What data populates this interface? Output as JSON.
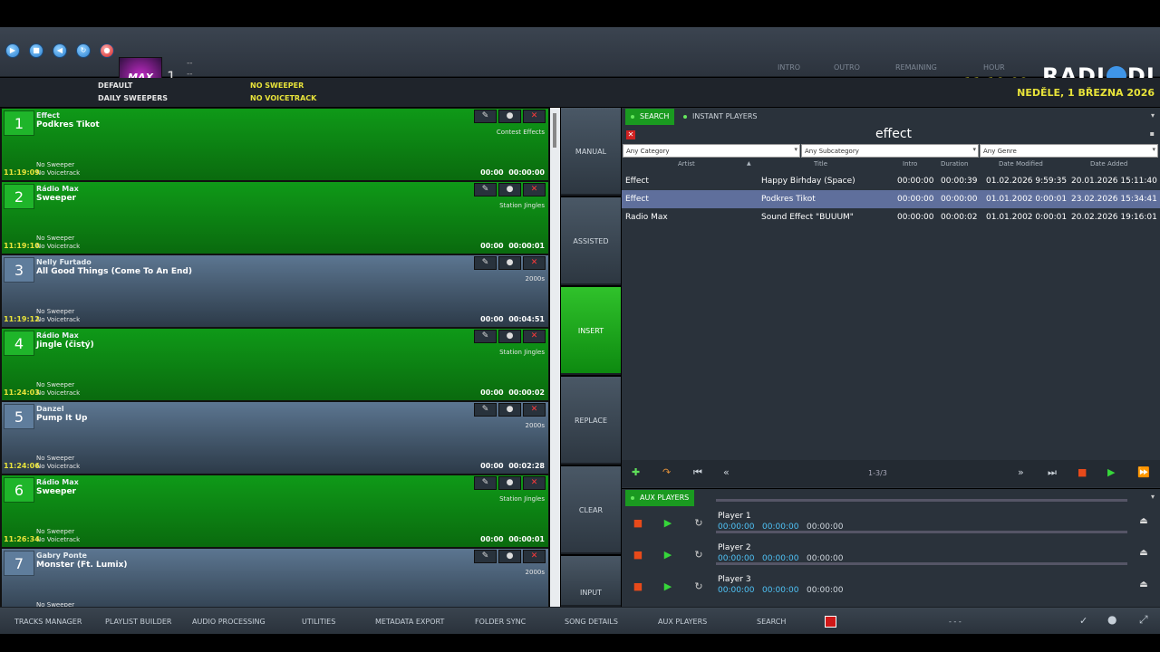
{
  "player": {
    "deck_number": "1",
    "logo_text": "MAX",
    "dashes": [
      "--",
      "--",
      "--"
    ],
    "labels": {
      "intro": "INTRO",
      "outro": "OUTRO",
      "remaining": "REMAINING",
      "hour": "HOUR"
    },
    "values": {
      "intro": "--:--",
      "outro": "--:--:--",
      "remaining": "--:--:--",
      "hour": "11:19:09"
    },
    "brand": "RADIODJ"
  },
  "info": {
    "flags": [
      "DEFAULT",
      "DAILY SWEEPERS",
      "NO SWEEPER",
      "NO VOICETRACK"
    ],
    "date": "NEDĚLE, 1 BŘEZNA 2026"
  },
  "playlist": [
    {
      "num": "1",
      "artist": "Effect",
      "title": "Podkres Tikot",
      "category": "Contest Effects",
      "sweeper": "No Sweeper",
      "voicetrack": "No Voicetrack",
      "time": "11:19:09",
      "intro": "00:00",
      "dur": "00:00:00",
      "color": "green"
    },
    {
      "num": "2",
      "artist": "Rádio Max",
      "title": "Sweeper",
      "category": "Station Jingles",
      "sweeper": "No Sweeper",
      "voicetrack": "No Voicetrack",
      "time": "11:19:10",
      "intro": "00:00",
      "dur": "00:00:01",
      "color": "green"
    },
    {
      "num": "3",
      "artist": "Nelly Furtado",
      "title": "All Good Things (Come To An End)",
      "category": "2000s",
      "sweeper": "No Sweeper",
      "voicetrack": "No Voicetrack",
      "time": "11:19:12",
      "intro": "00:00",
      "dur": "00:04:51",
      "color": "blue"
    },
    {
      "num": "4",
      "artist": "Rádio Max",
      "title": "Jingle (čistý)",
      "category": "Station Jingles",
      "sweeper": "No Sweeper",
      "voicetrack": "No Voicetrack",
      "time": "11:24:03",
      "intro": "00:00",
      "dur": "00:00:02",
      "color": "green"
    },
    {
      "num": "5",
      "artist": "Danzel",
      "title": "Pump It Up",
      "category": "2000s",
      "sweeper": "No Sweeper",
      "voicetrack": "No Voicetrack",
      "time": "11:24:06",
      "intro": "00:00",
      "dur": "00:02:28",
      "color": "blue"
    },
    {
      "num": "6",
      "artist": "Rádio Max",
      "title": "Sweeper",
      "category": "Station Jingles",
      "sweeper": "No Sweeper",
      "voicetrack": "No Voicetrack",
      "time": "11:26:34",
      "intro": "00:00",
      "dur": "00:00:01",
      "color": "green"
    },
    {
      "num": "7",
      "artist": "Gabry Ponte",
      "title": "Monster (Ft. Lumix)",
      "category": "2000s",
      "sweeper": "No Sweeper",
      "voicetrack": "",
      "time": "",
      "intro": "",
      "dur": "",
      "color": "blue"
    }
  ],
  "modes": [
    "MANUAL",
    "ASSISTED",
    "INSERT",
    "REPLACE",
    "CLEAR",
    "INPUT"
  ],
  "search": {
    "tabs": [
      "SEARCH",
      "INSTANT PLAYERS"
    ],
    "query": "effect",
    "filters": [
      "Any Category",
      "Any Subcategory",
      "Any Genre"
    ],
    "columns": [
      "Artist",
      "Title",
      "Intro",
      "Duration",
      "Date Modified",
      "Date Added"
    ],
    "rows": [
      {
        "artist": "Effect",
        "title": "Happy Birhday (Space)",
        "intro": "00:00:00",
        "duration": "00:00:39",
        "modified": "01.02.2026 9:59:35",
        "added": "20.01.2026 15:11:40"
      },
      {
        "artist": "Effect",
        "title": "Podkres Tikot",
        "intro": "00:00:00",
        "duration": "00:00:00",
        "modified": "01.01.2002 0:00:01",
        "added": "23.02.2026 15:34:41"
      },
      {
        "artist": "Radio Max",
        "title": "Sound Effect \"BUUUM\"",
        "intro": "00:00:00",
        "duration": "00:00:02",
        "modified": "01.01.2002 0:00:01",
        "added": "20.02.2026 19:16:01"
      }
    ],
    "pager": "1-3/3"
  },
  "aux": {
    "tab": "AUX PLAYERS",
    "players": [
      {
        "name": "Player 1",
        "t1": "00:00:00",
        "t2": "00:00:00",
        "t3": "00:00:00"
      },
      {
        "name": "Player 2",
        "t1": "00:00:00",
        "t2": "00:00:00",
        "t3": "00:00:00"
      },
      {
        "name": "Player 3",
        "t1": "00:00:00",
        "t2": "00:00:00",
        "t3": "00:00:00"
      }
    ]
  },
  "bottom": {
    "items": [
      "TRACKS MANAGER",
      "PLAYLIST BUILDER",
      "AUDIO PROCESSING",
      "UTILITIES",
      "METADATA EXPORT",
      "FOLDER SYNC",
      "SONG DETAILS",
      "AUX PLAYERS",
      "SEARCH"
    ],
    "status": "- - -"
  },
  "colors": {
    "accent_green": "#1a9a20",
    "clock_yellow": "#e8e33a",
    "selected_row": "#5f6f9c"
  }
}
